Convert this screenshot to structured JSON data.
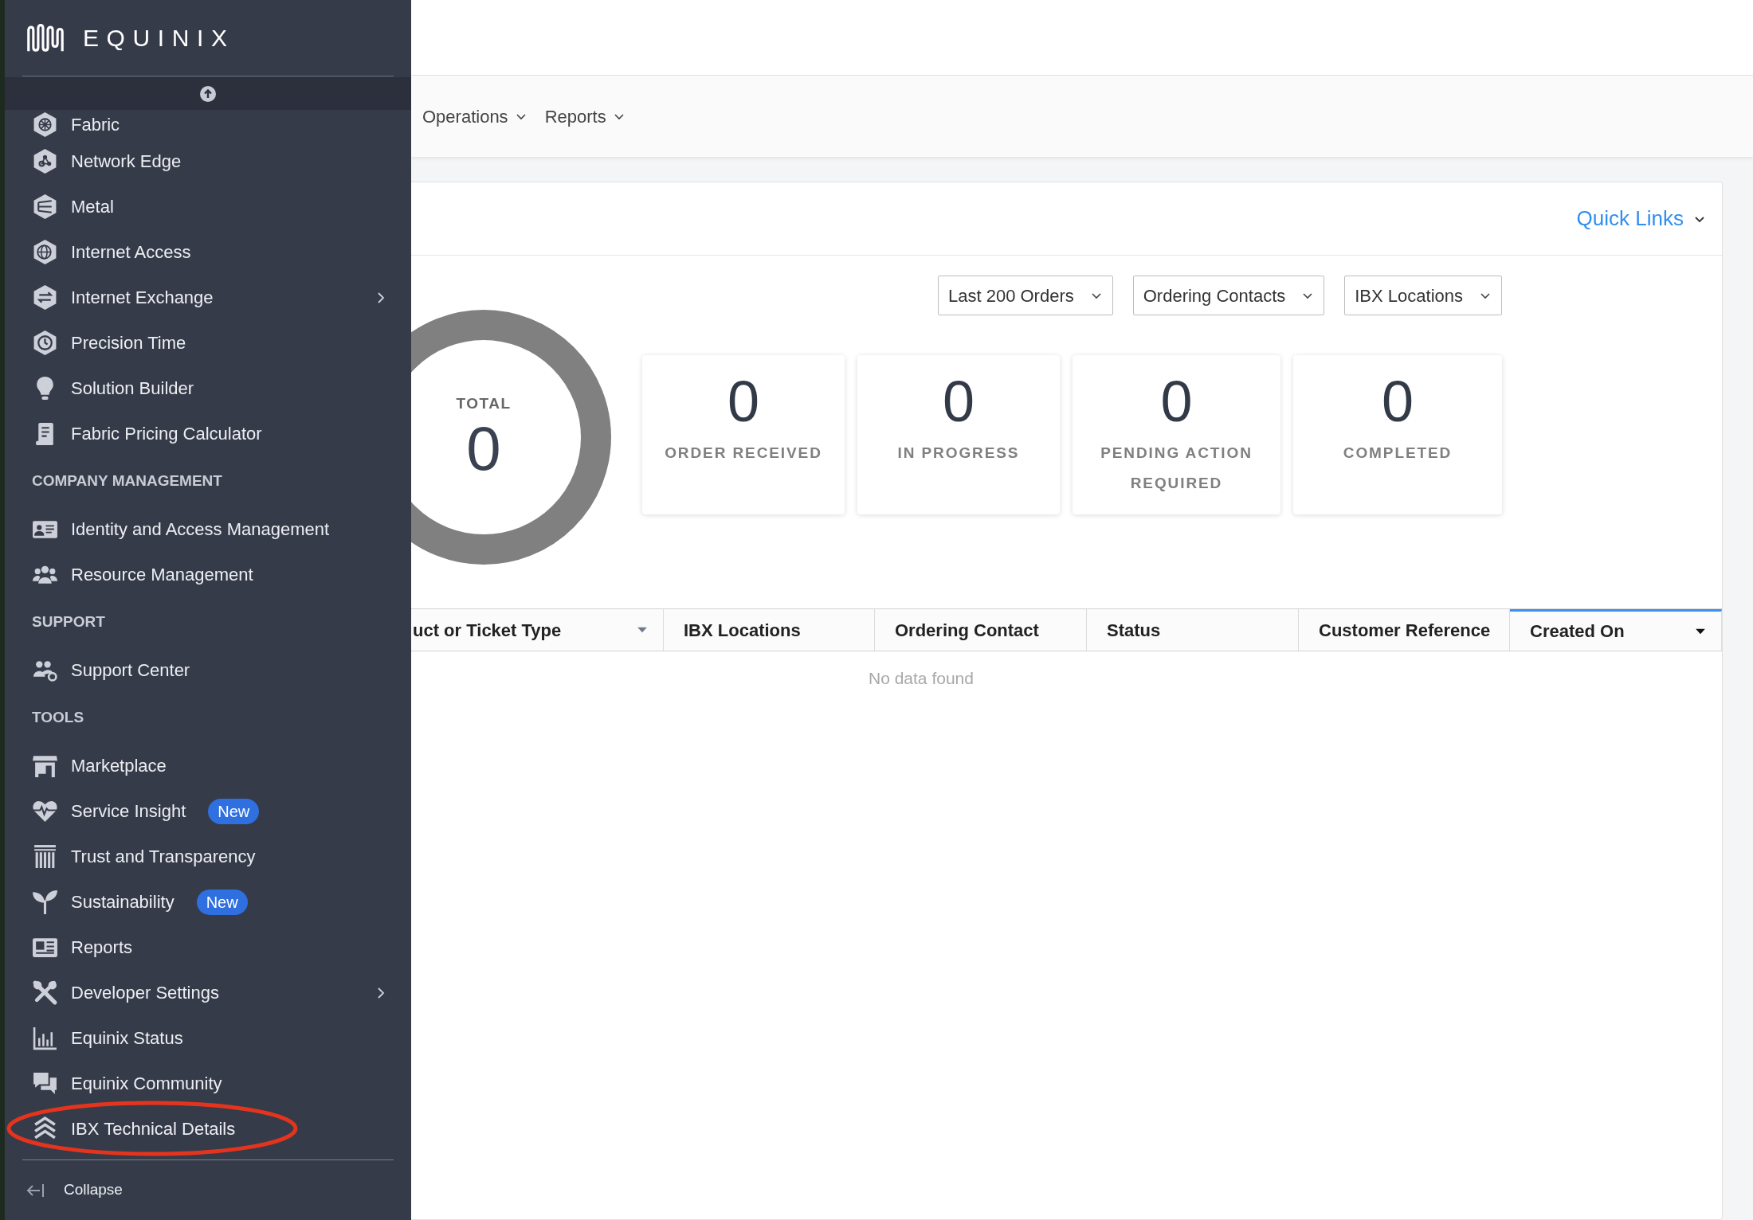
{
  "sidebar": {
    "logo": "EQUINIX",
    "sections": [
      {
        "items": [
          {
            "label": "Fabric",
            "has_submenu": false,
            "circled": false
          },
          {
            "label": "Network Edge",
            "has_submenu": false,
            "circled": false
          },
          {
            "label": "Metal",
            "has_submenu": false,
            "circled": false
          },
          {
            "label": "Internet Access",
            "has_submenu": false,
            "circled": false
          },
          {
            "label": "Internet Exchange",
            "has_submenu": true,
            "circled": false
          },
          {
            "label": "Precision Time",
            "has_submenu": false,
            "circled": false
          },
          {
            "label": "Solution Builder",
            "has_submenu": false,
            "circled": false
          },
          {
            "label": "Fabric Pricing Calculator",
            "has_submenu": false,
            "circled": false
          }
        ]
      },
      {
        "heading": "COMPANY MANAGEMENT",
        "items": [
          {
            "label": "Identity and Access Management",
            "has_submenu": false,
            "circled": false
          },
          {
            "label": "Resource Management",
            "has_submenu": false,
            "circled": false
          }
        ]
      },
      {
        "heading": "SUPPORT",
        "items": [
          {
            "label": "Support Center",
            "has_submenu": false,
            "circled": false
          }
        ]
      },
      {
        "heading": "TOOLS",
        "items": [
          {
            "label": "Marketplace",
            "has_submenu": false,
            "circled": false
          },
          {
            "label": "Service Insight",
            "badge": "New",
            "has_submenu": false,
            "circled": false
          },
          {
            "label": "Trust and Transparency",
            "has_submenu": false,
            "circled": false
          },
          {
            "label": "Sustainability",
            "badge": "New",
            "has_submenu": false,
            "circled": false
          },
          {
            "label": "Reports",
            "has_submenu": false,
            "circled": false
          },
          {
            "label": "Developer Settings",
            "has_submenu": true,
            "circled": false
          },
          {
            "label": "Equinix Status",
            "has_submenu": false,
            "circled": false
          },
          {
            "label": "Equinix Community",
            "has_submenu": false,
            "circled": false
          },
          {
            "label": "IBX Technical Details",
            "has_submenu": false,
            "circled": true
          }
        ]
      }
    ],
    "collapse": "Collapse"
  },
  "nav": [
    {
      "label": "Operations"
    },
    {
      "label": "Reports"
    }
  ],
  "card": {
    "quick_links": "Quick Links",
    "filters": [
      "Last 200 Orders",
      "Ordering Contacts",
      "IBX Locations"
    ],
    "total": {
      "label": "TOTAL",
      "value": "0"
    },
    "stats": [
      {
        "value": "0",
        "label": "ORDER RECEIVED"
      },
      {
        "value": "0",
        "label": "IN PROGRESS"
      },
      {
        "value": "0",
        "label": "PENDING ACTION REQUIRED"
      },
      {
        "value": "0",
        "label": "COMPLETED"
      }
    ],
    "table": {
      "columns": [
        {
          "label": "uct or Ticket Type",
          "sort_icon": true,
          "selected": false
        },
        {
          "label": "IBX Locations",
          "sort_icon": false,
          "selected": false
        },
        {
          "label": "Ordering Contact",
          "sort_icon": false,
          "selected": false
        },
        {
          "label": "Status",
          "sort_icon": false,
          "selected": false
        },
        {
          "label": "Customer Reference",
          "sort_icon": false,
          "selected": false
        },
        {
          "label": "Created On",
          "sort_icon": true,
          "selected": true
        }
      ],
      "empty": "No data found"
    }
  }
}
